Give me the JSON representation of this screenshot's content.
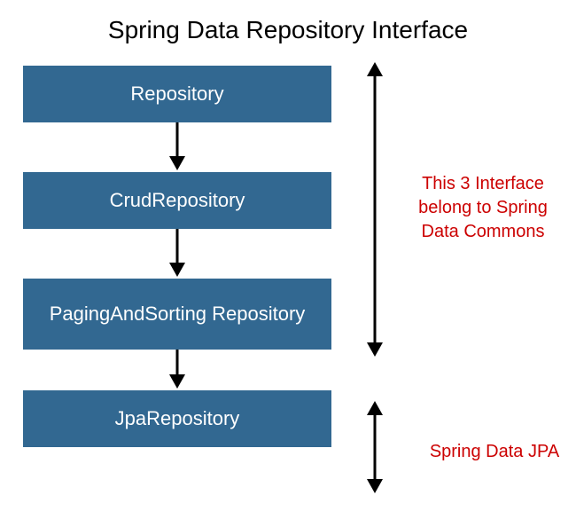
{
  "title": "Spring Data Repository Interface",
  "boxes": {
    "b1": "Repository",
    "b2": "CrudRepository",
    "b3": "PagingAndSorting Repository",
    "b4": "JpaRepository"
  },
  "annotations": {
    "commons": "This 3 Interface belong to Spring Data Commons",
    "jpa": "Spring Data JPA"
  },
  "colors": {
    "box_bg": "#326891",
    "box_text": "#ffffff",
    "annotation_text": "#cc0000",
    "arrow": "#000000"
  }
}
